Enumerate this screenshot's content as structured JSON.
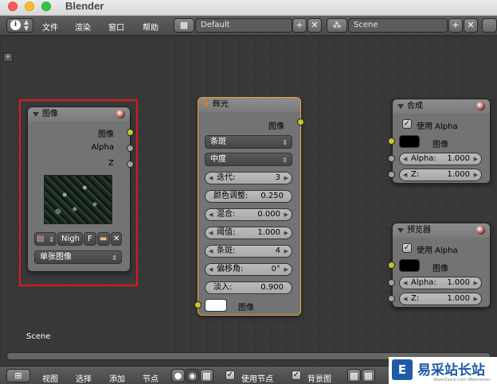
{
  "window": {
    "title": "Blender"
  },
  "header": {
    "menus": [
      "文件",
      "渲染",
      "窗口",
      "帮助"
    ],
    "screen_layout": "Default",
    "scene": "Scene"
  },
  "canvas": {
    "scene_label": "Scene"
  },
  "image_node": {
    "title": "图像",
    "outputs": [
      "图像",
      "Alpha",
      "Z"
    ],
    "image_name": "Nigh",
    "fake_user": "F",
    "source": "单张图像"
  },
  "glare_node": {
    "title": "辉光",
    "output": "图像",
    "glare_type": "条斑",
    "quality": "中度",
    "fields": [
      {
        "name": "迭代:",
        "value": "3"
      },
      {
        "name": "颜色调整:",
        "value": "0.250"
      },
      {
        "name": "混合:",
        "value": "0.000"
      },
      {
        "name": "阈值:",
        "value": "1.000"
      },
      {
        "name": "条斑:",
        "value": "4"
      },
      {
        "name": "偏移角:",
        "value": "0°"
      },
      {
        "name": "淡入:",
        "value": "0.900"
      }
    ],
    "input": "图像"
  },
  "composite_node": {
    "title": "合成",
    "use_alpha": "使用 Alpha",
    "image_input": "图像",
    "alpha": {
      "name": "Alpha:",
      "value": "1.000"
    },
    "z": {
      "name": "Z:",
      "value": "1.000"
    }
  },
  "viewer_node": {
    "title": "预览器",
    "use_alpha": "使用 Alpha",
    "image_input": "图像",
    "alpha": {
      "name": "Alpha:",
      "value": "1.000"
    },
    "z": {
      "name": "Z:",
      "value": "1.000"
    }
  },
  "footer": {
    "menus": [
      "视图",
      "选择",
      "添加",
      "节点"
    ],
    "use_nodes": "使用节点",
    "backdrop": "背景图"
  },
  "watermark": {
    "logo": "E",
    "text": "易采站长站",
    "small": "Www.Easck.Com Webmaster"
  },
  "colors": {
    "selection_box": "#e01818",
    "socket_yellow": "#c7c729",
    "socket_gray": "#a1a1a1",
    "active_node_border": "#f0a030"
  }
}
